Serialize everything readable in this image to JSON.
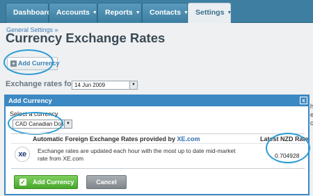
{
  "nav": {
    "tabs": [
      {
        "label": "Dashboard",
        "chevron": false
      },
      {
        "label": "Accounts",
        "chevron": true
      },
      {
        "label": "Reports",
        "chevron": true
      },
      {
        "label": "Contacts",
        "chevron": true
      },
      {
        "label": "Settings",
        "chevron": true,
        "active": true
      }
    ],
    "chevron_glyph": "▼"
  },
  "breadcrumb": "General Settings »",
  "page_title": "Currency Exchange Rates",
  "add_currency_button": "Add Currency",
  "rates_for": {
    "label": "Exchange rates for",
    "date": "14 Jun 2009"
  },
  "right_edge_letters": [
    "h",
    "e",
    "c"
  ],
  "dialog": {
    "title": "Add Currency",
    "close_glyph": "x",
    "select_label": "Select a currency",
    "selected_currency": "CAD Canadian Dollar",
    "provider_heading_prefix": "Automatic Foreign Exchange Rates provided by ",
    "provider_link": "XE.com",
    "rate_heading": "Latest NZD Rate",
    "logo_text": "xe",
    "description": "Exchange rates are updated each hour with the most up to date mid-market rate from XE.com",
    "rate_value": "0.704928",
    "add_button": "Add Currency",
    "cancel_button": "Cancel"
  },
  "colors": {
    "nav_bg": "#3e7fa1",
    "dialog_border": "#3c88c2",
    "annotation_oval": "#2a9bd4",
    "add_button_green": "#48a62b"
  }
}
